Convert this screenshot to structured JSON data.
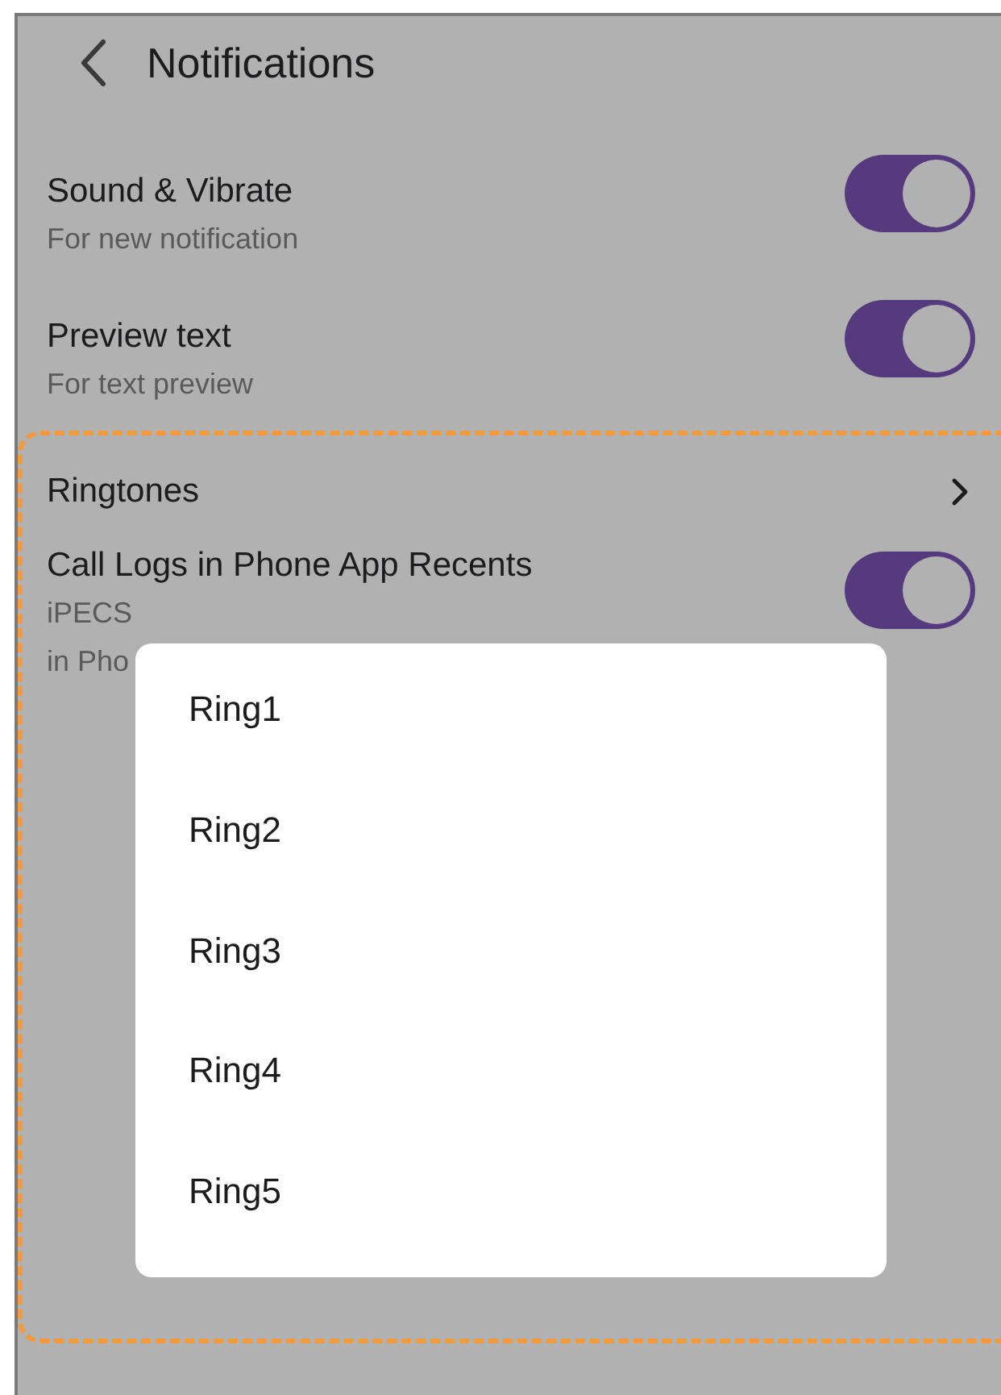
{
  "header": {
    "title": "Notifications"
  },
  "settings": [
    {
      "kind": "toggle",
      "title": "Sound & Vibrate",
      "description": [
        "For new notification"
      ],
      "on": true
    },
    {
      "kind": "toggle",
      "title": "Preview text",
      "description": [
        "For text preview"
      ],
      "on": true
    },
    {
      "kind": "link",
      "title": "Ringtones"
    },
    {
      "kind": "toggle",
      "title": "Call Logs in Phone App Recents",
      "description": [
        "iPECS",
        "in Pho"
      ],
      "on": true
    }
  ],
  "ringtone_menu": {
    "options": [
      "Ring1",
      "Ring2",
      "Ring3",
      "Ring4",
      "Ring5"
    ]
  }
}
